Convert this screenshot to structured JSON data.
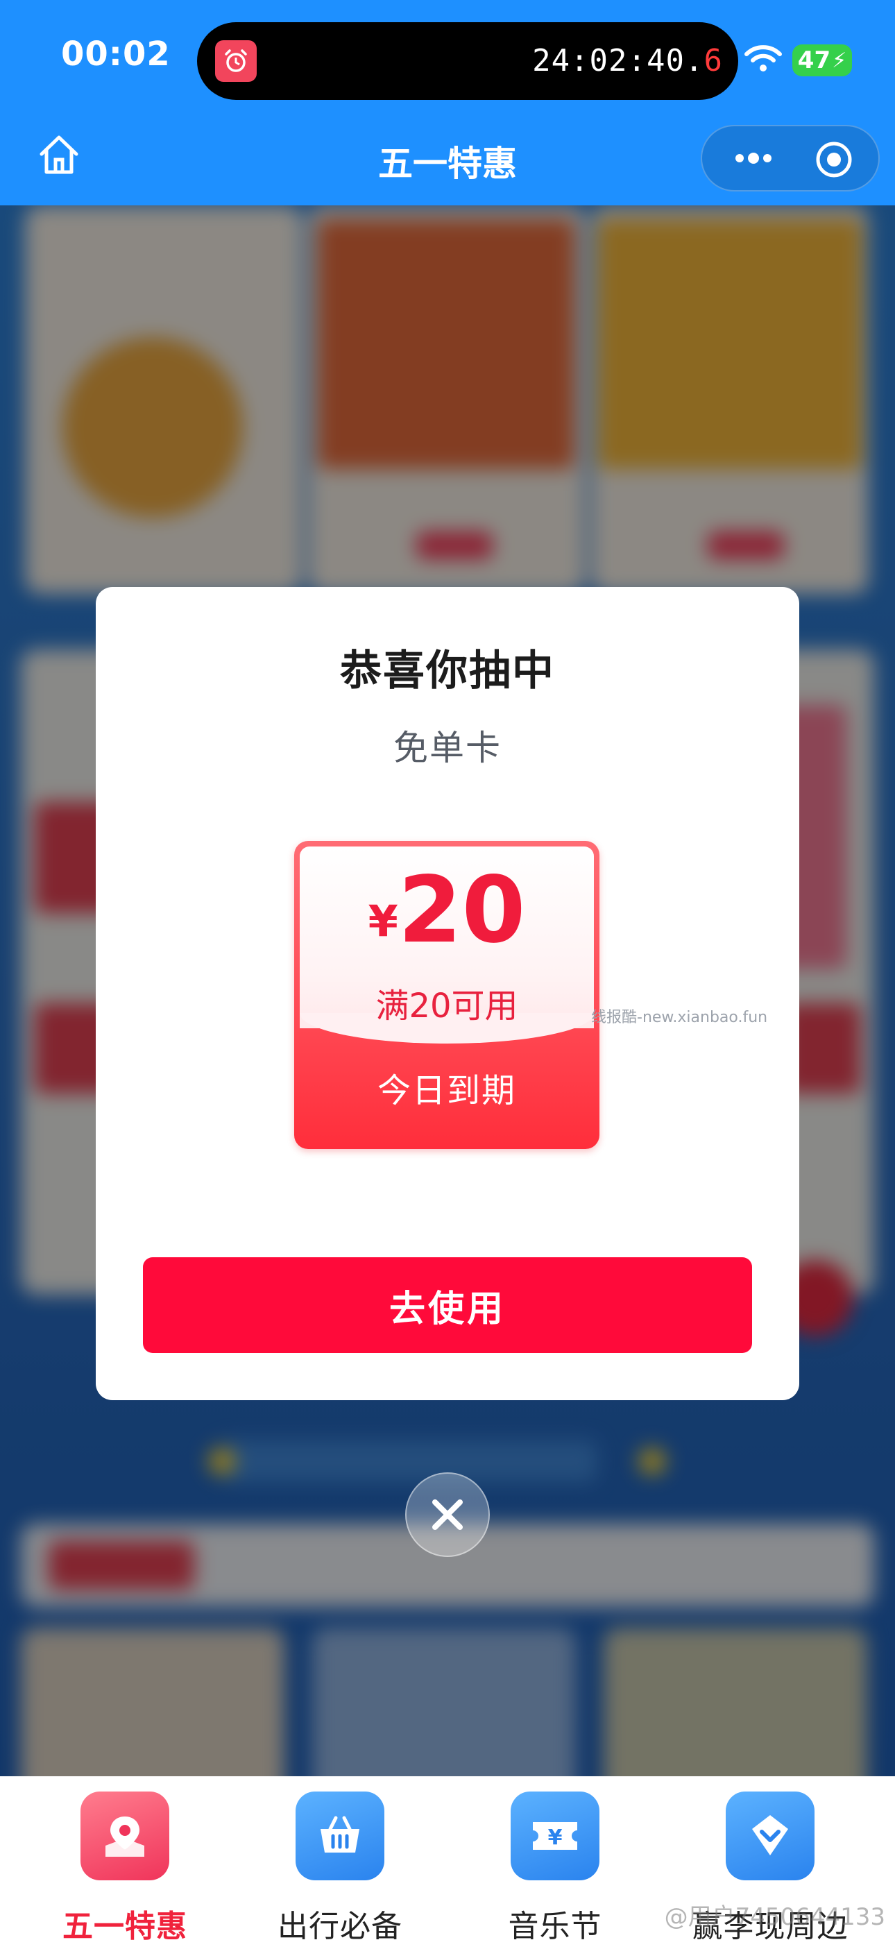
{
  "status_bar": {
    "time": "00:02",
    "timer_main": "24:02:40.",
    "timer_last": "6",
    "battery": "47"
  },
  "nav": {
    "title": "五一特惠"
  },
  "modal": {
    "title": "恭喜你抽中",
    "subtitle": "免单卡",
    "coupon": {
      "currency": "¥",
      "amount": "20",
      "condition": "满20可用",
      "expiry": "今日到期"
    },
    "watermark": "线报酷-new.xianbao.fun",
    "use_button": "去使用"
  },
  "tabs": [
    {
      "label": "五一特惠",
      "icon": "map-pin-icon",
      "color": "#f24b6a"
    },
    {
      "label": "出行必备",
      "icon": "basket-icon",
      "color": "#2f8ff3"
    },
    {
      "label": "音乐节",
      "icon": "ticket-icon",
      "color": "#2f8ff3"
    },
    {
      "label": "赢李现周边",
      "icon": "diamond-icon",
      "color": "#2f8ff3"
    }
  ],
  "weibo_credit": "@用户7450644133",
  "colors": {
    "primary_blue": "#1e90ff",
    "accent_red": "#ff0a3a"
  }
}
